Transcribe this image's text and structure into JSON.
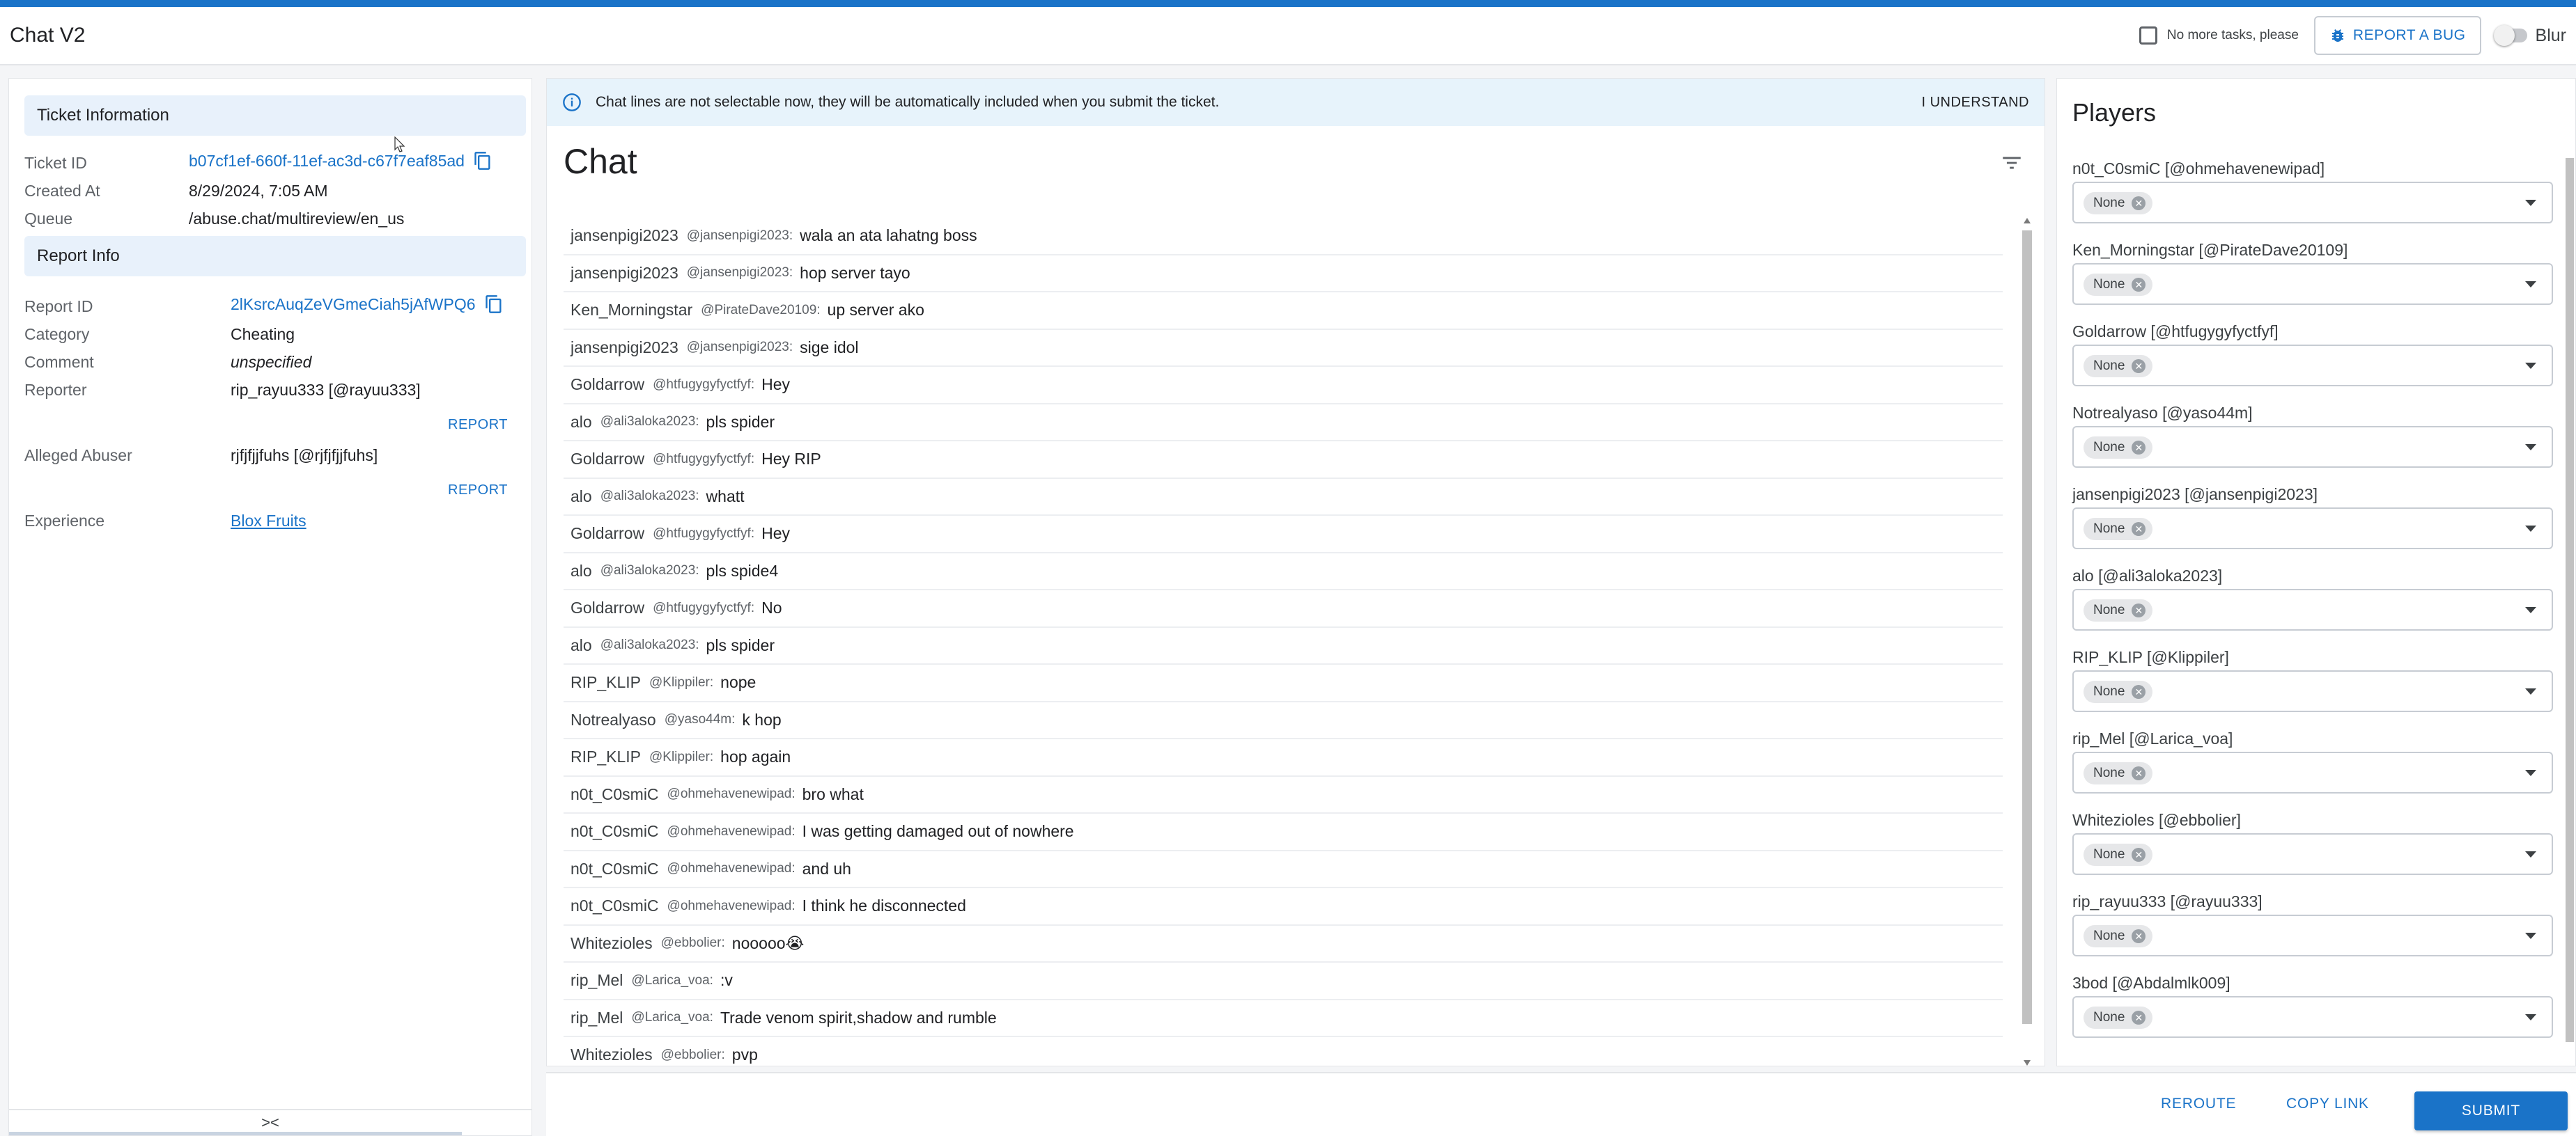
{
  "header": {
    "title": "Chat V2",
    "no_more_tasks_label": "No more tasks, please",
    "report_bug_label": "REPORT A BUG",
    "blur_label": "Blur"
  },
  "ticket": {
    "section_title": "Ticket Information",
    "ticket_id_label": "Ticket ID",
    "ticket_id": "b07cf1ef-660f-11ef-ac3d-c67f7eaf85ad",
    "created_at_label": "Created At",
    "created_at": "8/29/2024, 7:05 AM",
    "queue_label": "Queue",
    "queue": "/abuse.chat/multireview/en_us"
  },
  "report": {
    "section_title": "Report Info",
    "report_id_label": "Report ID",
    "report_id": "2lKsrcAuqZeVGmeCiah5jAfWPQ6",
    "category_label": "Category",
    "category": "Cheating",
    "comment_label": "Comment",
    "comment": "unspecified",
    "reporter_label": "Reporter",
    "reporter": "rip_rayuu333 [@rayuu333]",
    "report_link_label": "REPORT",
    "alleged_abuser_label": "Alleged Abuser",
    "alleged_abuser": "rjfjfjjfuhs [@rjfjfjjfuhs]",
    "experience_label": "Experience",
    "experience": "Blox Fruits"
  },
  "collapse_label": "><",
  "banner": {
    "text": "Chat lines are not selectable now, they will be automatically included when you submit the ticket.",
    "understand_label": "I UNDERSTAND"
  },
  "chat": {
    "title": "Chat",
    "messages": [
      {
        "name": "jansenpigi2023",
        "handle": "@jansenpigi2023:",
        "text": "wala an ata lahatng boss"
      },
      {
        "name": "jansenpigi2023",
        "handle": "@jansenpigi2023:",
        "text": "hop server tayo"
      },
      {
        "name": "Ken_Morningstar",
        "handle": "@PirateDave20109:",
        "text": "up server ako"
      },
      {
        "name": "jansenpigi2023",
        "handle": "@jansenpigi2023:",
        "text": "sige idol"
      },
      {
        "name": "Goldarrow",
        "handle": "@htfugygyfyctfyf:",
        "text": "Hey"
      },
      {
        "name": "alo",
        "handle": "@ali3aloka2023:",
        "text": "pls spider"
      },
      {
        "name": "Goldarrow",
        "handle": "@htfugygyfyctfyf:",
        "text": "Hey RIP"
      },
      {
        "name": "alo",
        "handle": "@ali3aloka2023:",
        "text": "whatt"
      },
      {
        "name": "Goldarrow",
        "handle": "@htfugygyfyctfyf:",
        "text": "Hey"
      },
      {
        "name": "alo",
        "handle": "@ali3aloka2023:",
        "text": "pls spide4"
      },
      {
        "name": "Goldarrow",
        "handle": "@htfugygyfyctfyf:",
        "text": "No"
      },
      {
        "name": "alo",
        "handle": "@ali3aloka2023:",
        "text": "pls spider"
      },
      {
        "name": "RIP_KLIP",
        "handle": "@Klippiler:",
        "text": "nope"
      },
      {
        "name": "Notrealyaso",
        "handle": "@yaso44m:",
        "text": "k hop"
      },
      {
        "name": "RIP_KLIP",
        "handle": "@Klippiler:",
        "text": "hop again"
      },
      {
        "name": "n0t_C0smiC",
        "handle": "@ohmehavenewipad:",
        "text": "bro what"
      },
      {
        "name": "n0t_C0smiC",
        "handle": "@ohmehavenewipad:",
        "text": "I was getting damaged out of nowhere"
      },
      {
        "name": "n0t_C0smiC",
        "handle": "@ohmehavenewipad:",
        "text": "and uh"
      },
      {
        "name": "n0t_C0smiC",
        "handle": "@ohmehavenewipad:",
        "text": "I think he disconnected"
      },
      {
        "name": "Whitezioles",
        "handle": "@ebbolier:",
        "text": "nooooo😭"
      },
      {
        "name": "rip_Mel",
        "handle": "@Larica_voa:",
        "text": ":v"
      },
      {
        "name": "rip_Mel",
        "handle": "@Larica_voa:",
        "text": "Trade venom spirit,shadow and rumble"
      },
      {
        "name": "Whitezioles",
        "handle": "@ebbolier:",
        "text": "pvp"
      }
    ]
  },
  "players": {
    "title": "Players",
    "none_label": "None",
    "list": [
      {
        "label": "n0t_C0smiC [@ohmehavenewipad]"
      },
      {
        "label": "Ken_Morningstar [@PirateDave20109]"
      },
      {
        "label": "Goldarrow [@htfugygyfyctfyf]"
      },
      {
        "label": "Notrealyaso [@yaso44m]"
      },
      {
        "label": "jansenpigi2023 [@jansenpigi2023]"
      },
      {
        "label": "alo [@ali3aloka2023]"
      },
      {
        "label": "RIP_KLIP [@Klippiler]"
      },
      {
        "label": "rip_Mel [@Larica_voa]"
      },
      {
        "label": "Whitezioles [@ebbolier]"
      },
      {
        "label": "rip_rayuu333 [@rayuu333]"
      },
      {
        "label": "3bod [@Abdalmlk009]"
      }
    ]
  },
  "footer": {
    "reroute_label": "REROUTE",
    "copy_link_label": "COPY LINK",
    "submit_label": "SUBMIT"
  },
  "colors": {
    "accent": "#1a73c8",
    "banner_bg": "#e7f3fb",
    "section_bg": "#e8f1fb"
  }
}
